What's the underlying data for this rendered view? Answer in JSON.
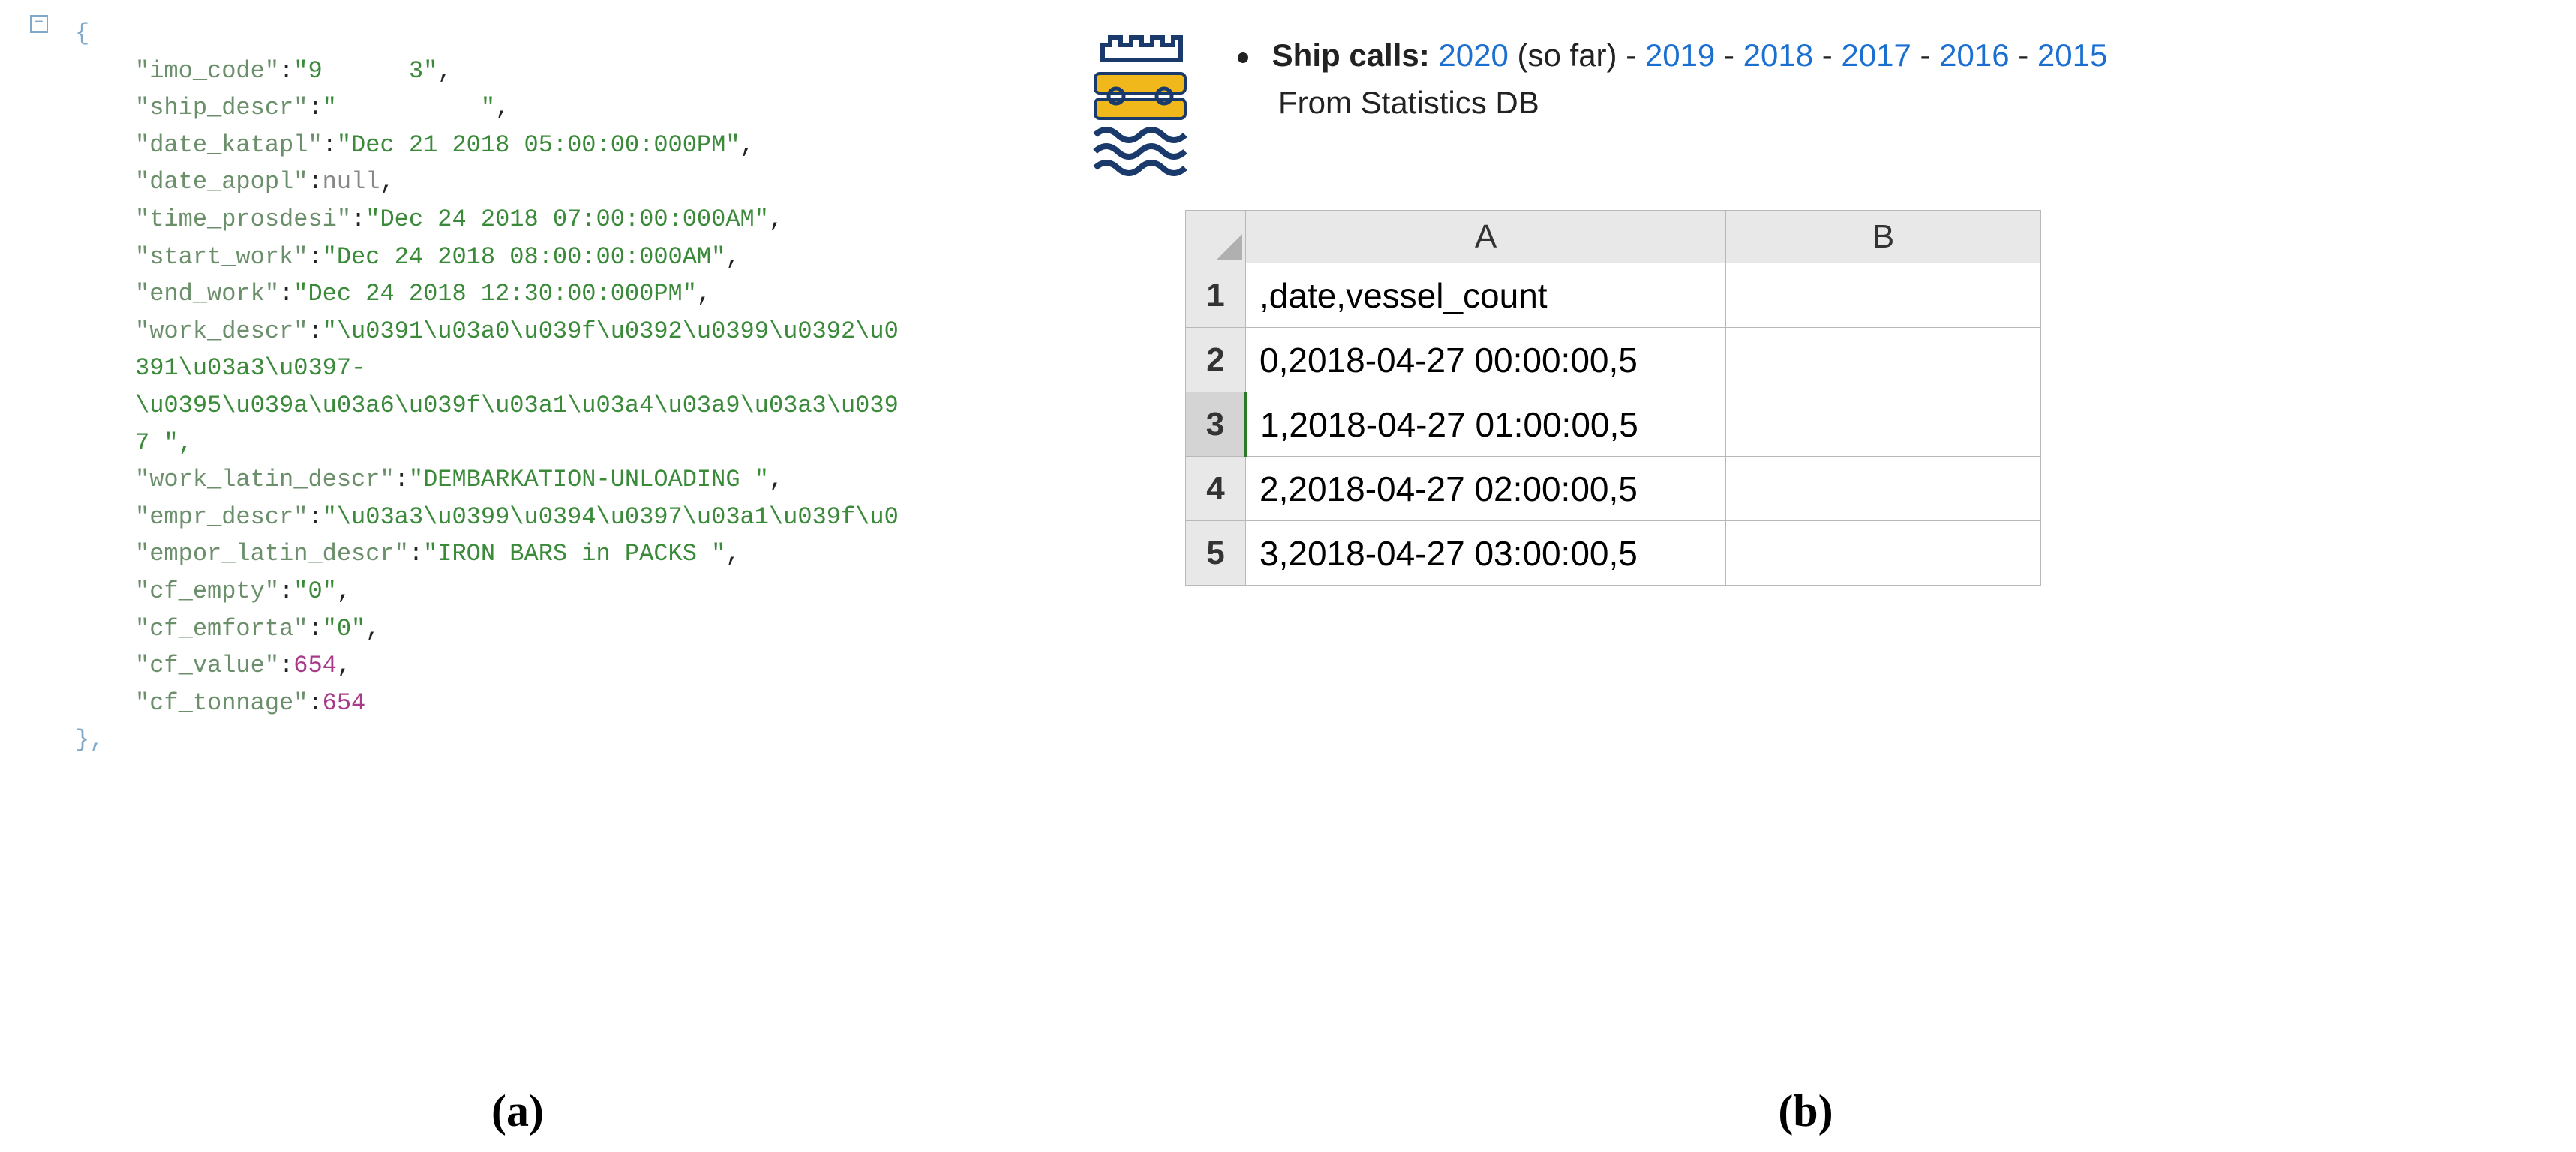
{
  "json_sample": {
    "open_brace": "{",
    "close_brace": "},",
    "lines": [
      {
        "key": "\"imo_code\"",
        "val_prefix": "\"9",
        "val_suffix": "3\"",
        "type": "string_blur"
      },
      {
        "key": "\"ship_descr\"",
        "val_prefix": "\"",
        "val_suffix": "\"",
        "type": "string_blur"
      },
      {
        "key": "\"date_katapl\"",
        "val": "\"Dec 21 2018 05:00:00:000PM\"",
        "type": "string"
      },
      {
        "key": "\"date_apopl\"",
        "val": "null",
        "type": "null"
      },
      {
        "key": "\"time_prosdesi\"",
        "val": "\"Dec 24 2018 07:00:00:000AM\"",
        "type": "string"
      },
      {
        "key": "\"start_work\"",
        "val": "\"Dec 24 2018 08:00:00:000AM\"",
        "type": "string"
      },
      {
        "key": "\"end_work\"",
        "val": "\"Dec 24 2018 12:30:00:000PM\"",
        "type": "string"
      },
      {
        "key": "\"work_descr\"",
        "val": "\"\\u0391\\u03a0\\u039f\\u0392\\u0399\\u0392\\u0",
        "type": "string_cont"
      },
      {
        "cont": "391\\u03a3\\u0397-",
        "type": "cont"
      },
      {
        "cont": "\\u0395\\u039a\\u03a6\\u039f\\u03a1\\u03a4\\u03a9\\u03a3\\u039",
        "type": "cont"
      },
      {
        "cont": "7 \",",
        "type": "cont_end"
      },
      {
        "key": "\"work_latin_descr\"",
        "val": "\"DEMBARKATION-UNLOADING \"",
        "type": "string"
      },
      {
        "key": "\"empr_descr\"",
        "val": "\"\\u03a3\\u0399\\u0394\\u0397\\u03a1\\u039f\\u0",
        "type": "string_trunc"
      },
      {
        "key": "\"empor_latin_descr\"",
        "val": "\"IRON BARS in PACKS \"",
        "type": "string"
      },
      {
        "key": "\"cf_empty\"",
        "val": "\"0\"",
        "type": "string"
      },
      {
        "key": "\"cf_emforta\"",
        "val": "\"0\"",
        "type": "string"
      },
      {
        "key": "\"cf_value\"",
        "val": "654",
        "type": "number"
      },
      {
        "key": "\"cf_tonnage\"",
        "val": "654",
        "type": "number_last"
      }
    ]
  },
  "ship_calls": {
    "label": "Ship calls:",
    "years": [
      "2020",
      "2019",
      "2018",
      "2017",
      "2016",
      "2015"
    ],
    "suffix": "(so far)",
    "subtitle": "From Statistics DB"
  },
  "spreadsheet": {
    "col_headers": [
      "A",
      "B"
    ],
    "row_headers": [
      "1",
      "2",
      "3",
      "4",
      "5"
    ],
    "selected_row": "3",
    "cells": [
      [
        ",date,vessel_count",
        ""
      ],
      [
        "0,2018-04-27 00:00:00,5",
        ""
      ],
      [
        "1,2018-04-27 01:00:00,5",
        ""
      ],
      [
        "2,2018-04-27 02:00:00,5",
        ""
      ],
      [
        "3,2018-04-27 03:00:00,5",
        ""
      ]
    ]
  },
  "captions": {
    "a": "(a)",
    "b": "(b)"
  }
}
